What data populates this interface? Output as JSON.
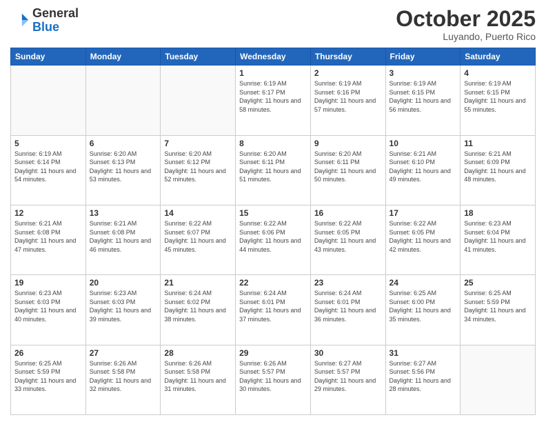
{
  "header": {
    "logo_general": "General",
    "logo_blue": "Blue",
    "month_title": "October 2025",
    "location": "Luyando, Puerto Rico"
  },
  "days_of_week": [
    "Sunday",
    "Monday",
    "Tuesday",
    "Wednesday",
    "Thursday",
    "Friday",
    "Saturday"
  ],
  "weeks": [
    [
      {
        "day": "",
        "info": ""
      },
      {
        "day": "",
        "info": ""
      },
      {
        "day": "",
        "info": ""
      },
      {
        "day": "1",
        "info": "Sunrise: 6:19 AM\nSunset: 6:17 PM\nDaylight: 11 hours\nand 58 minutes."
      },
      {
        "day": "2",
        "info": "Sunrise: 6:19 AM\nSunset: 6:16 PM\nDaylight: 11 hours\nand 57 minutes."
      },
      {
        "day": "3",
        "info": "Sunrise: 6:19 AM\nSunset: 6:15 PM\nDaylight: 11 hours\nand 56 minutes."
      },
      {
        "day": "4",
        "info": "Sunrise: 6:19 AM\nSunset: 6:15 PM\nDaylight: 11 hours\nand 55 minutes."
      }
    ],
    [
      {
        "day": "5",
        "info": "Sunrise: 6:19 AM\nSunset: 6:14 PM\nDaylight: 11 hours\nand 54 minutes."
      },
      {
        "day": "6",
        "info": "Sunrise: 6:20 AM\nSunset: 6:13 PM\nDaylight: 11 hours\nand 53 minutes."
      },
      {
        "day": "7",
        "info": "Sunrise: 6:20 AM\nSunset: 6:12 PM\nDaylight: 11 hours\nand 52 minutes."
      },
      {
        "day": "8",
        "info": "Sunrise: 6:20 AM\nSunset: 6:11 PM\nDaylight: 11 hours\nand 51 minutes."
      },
      {
        "day": "9",
        "info": "Sunrise: 6:20 AM\nSunset: 6:11 PM\nDaylight: 11 hours\nand 50 minutes."
      },
      {
        "day": "10",
        "info": "Sunrise: 6:21 AM\nSunset: 6:10 PM\nDaylight: 11 hours\nand 49 minutes."
      },
      {
        "day": "11",
        "info": "Sunrise: 6:21 AM\nSunset: 6:09 PM\nDaylight: 11 hours\nand 48 minutes."
      }
    ],
    [
      {
        "day": "12",
        "info": "Sunrise: 6:21 AM\nSunset: 6:08 PM\nDaylight: 11 hours\nand 47 minutes."
      },
      {
        "day": "13",
        "info": "Sunrise: 6:21 AM\nSunset: 6:08 PM\nDaylight: 11 hours\nand 46 minutes."
      },
      {
        "day": "14",
        "info": "Sunrise: 6:22 AM\nSunset: 6:07 PM\nDaylight: 11 hours\nand 45 minutes."
      },
      {
        "day": "15",
        "info": "Sunrise: 6:22 AM\nSunset: 6:06 PM\nDaylight: 11 hours\nand 44 minutes."
      },
      {
        "day": "16",
        "info": "Sunrise: 6:22 AM\nSunset: 6:05 PM\nDaylight: 11 hours\nand 43 minutes."
      },
      {
        "day": "17",
        "info": "Sunrise: 6:22 AM\nSunset: 6:05 PM\nDaylight: 11 hours\nand 42 minutes."
      },
      {
        "day": "18",
        "info": "Sunrise: 6:23 AM\nSunset: 6:04 PM\nDaylight: 11 hours\nand 41 minutes."
      }
    ],
    [
      {
        "day": "19",
        "info": "Sunrise: 6:23 AM\nSunset: 6:03 PM\nDaylight: 11 hours\nand 40 minutes."
      },
      {
        "day": "20",
        "info": "Sunrise: 6:23 AM\nSunset: 6:03 PM\nDaylight: 11 hours\nand 39 minutes."
      },
      {
        "day": "21",
        "info": "Sunrise: 6:24 AM\nSunset: 6:02 PM\nDaylight: 11 hours\nand 38 minutes."
      },
      {
        "day": "22",
        "info": "Sunrise: 6:24 AM\nSunset: 6:01 PM\nDaylight: 11 hours\nand 37 minutes."
      },
      {
        "day": "23",
        "info": "Sunrise: 6:24 AM\nSunset: 6:01 PM\nDaylight: 11 hours\nand 36 minutes."
      },
      {
        "day": "24",
        "info": "Sunrise: 6:25 AM\nSunset: 6:00 PM\nDaylight: 11 hours\nand 35 minutes."
      },
      {
        "day": "25",
        "info": "Sunrise: 6:25 AM\nSunset: 5:59 PM\nDaylight: 11 hours\nand 34 minutes."
      }
    ],
    [
      {
        "day": "26",
        "info": "Sunrise: 6:25 AM\nSunset: 5:59 PM\nDaylight: 11 hours\nand 33 minutes."
      },
      {
        "day": "27",
        "info": "Sunrise: 6:26 AM\nSunset: 5:58 PM\nDaylight: 11 hours\nand 32 minutes."
      },
      {
        "day": "28",
        "info": "Sunrise: 6:26 AM\nSunset: 5:58 PM\nDaylight: 11 hours\nand 31 minutes."
      },
      {
        "day": "29",
        "info": "Sunrise: 6:26 AM\nSunset: 5:57 PM\nDaylight: 11 hours\nand 30 minutes."
      },
      {
        "day": "30",
        "info": "Sunrise: 6:27 AM\nSunset: 5:57 PM\nDaylight: 11 hours\nand 29 minutes."
      },
      {
        "day": "31",
        "info": "Sunrise: 6:27 AM\nSunset: 5:56 PM\nDaylight: 11 hours\nand 28 minutes."
      },
      {
        "day": "",
        "info": ""
      }
    ]
  ]
}
